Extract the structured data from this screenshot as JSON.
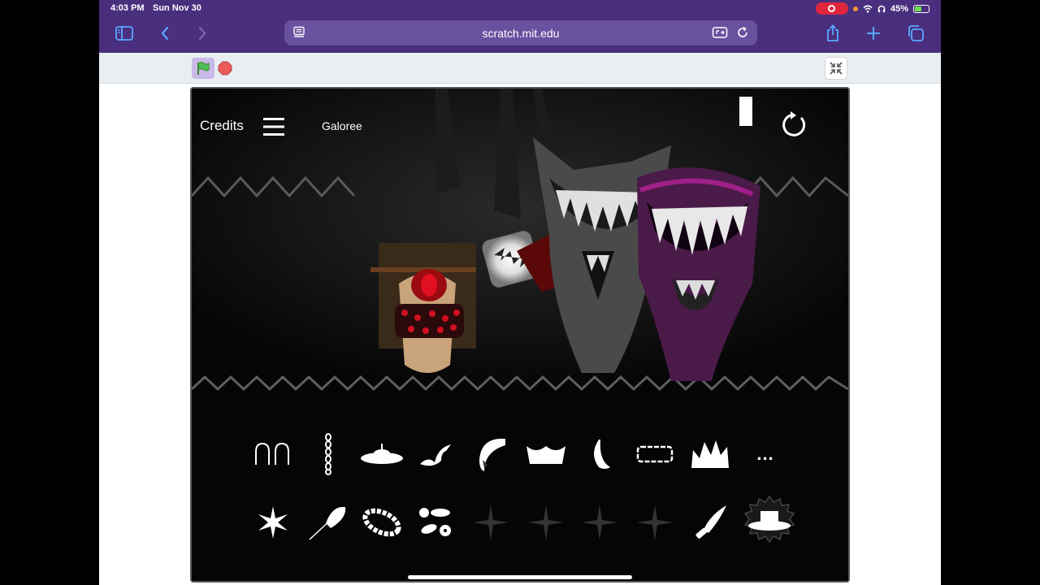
{
  "status": {
    "time": "4:03 PM",
    "date": "Sun Nov 30",
    "battery": "45%",
    "battery_level": 0.45
  },
  "browser": {
    "url": "scratch.mit.edu"
  },
  "game": {
    "credits_label": "Credits",
    "mod_name": "Galoree",
    "icons_row1": [
      "twin-pods-icon",
      "chain-icon",
      "saucer-icon",
      "claw-swirl-icon",
      "fang-arc-icon",
      "crown-icon",
      "crescent-icon",
      "cage-icon",
      "spiky-crown-icon",
      "more-icon"
    ],
    "icons_row2": [
      "burst-icon",
      "feather-icon",
      "bead-ring-icon",
      "dot-cluster-icon",
      "locked-star-icon",
      "locked-star-icon",
      "locked-star-icon",
      "locked-star-icon",
      "knife-icon",
      "top-hat-icon"
    ],
    "more_label": "..."
  },
  "colors": {
    "browser_chrome": "#4a2f7e",
    "url_field": "#6a51a0",
    "record": "#e0263c",
    "stage_bg": "#050505",
    "accent_red": "#b0101a",
    "accent_purple": "#a0208a"
  }
}
